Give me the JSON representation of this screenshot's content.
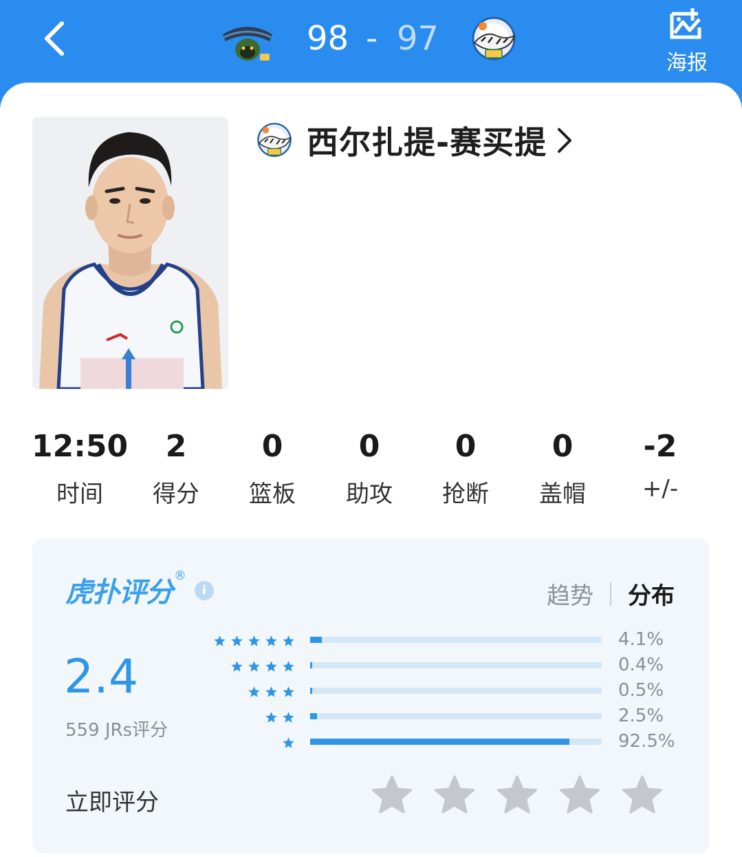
{
  "header": {
    "home_score": "98",
    "separator": "-",
    "away_score": "97",
    "poster_label": "海报",
    "icons": {
      "back": "chevron-left-icon",
      "poster": "image-icon",
      "home_logo": "monkey-kings-logo",
      "away_logo": "xinjiang-tigers-logo"
    }
  },
  "player": {
    "name": "西尔扎提-赛买提",
    "team_logo": "xinjiang-tigers-logo",
    "photo": "player-headshot"
  },
  "stats": [
    {
      "value": "12:50",
      "label": "时间"
    },
    {
      "value": "2",
      "label": "得分"
    },
    {
      "value": "0",
      "label": "篮板"
    },
    {
      "value": "0",
      "label": "助攻"
    },
    {
      "value": "0",
      "label": "抢断"
    },
    {
      "value": "0",
      "label": "盖帽"
    },
    {
      "value": "-2",
      "label": "+/-"
    }
  ],
  "rating": {
    "brand": "虎扑评分",
    "registered": "®",
    "info": "i",
    "tab_trend": "趋势",
    "tab_distribution": "分布",
    "active_tab": "分布",
    "score": "2.4",
    "count": "559 JRs评分",
    "distribution": [
      {
        "stars": 5,
        "percent": "4.1%",
        "fraction": 0.041
      },
      {
        "stars": 4,
        "percent": "0.4%",
        "fraction": 0.004
      },
      {
        "stars": 3,
        "percent": "0.5%",
        "fraction": 0.005
      },
      {
        "stars": 2,
        "percent": "2.5%",
        "fraction": 0.025
      },
      {
        "stars": 1,
        "percent": "92.5%",
        "fraction": 0.925
      }
    ],
    "rate_now": "立即评分",
    "rate_star_count": 5
  },
  "colors": {
    "header_bg": "#2b8cf0",
    "accent": "#2f96e6",
    "track": "#d3e7f7",
    "rating_bg": "#f2f7fc",
    "star_empty": "#c4c7cd"
  }
}
